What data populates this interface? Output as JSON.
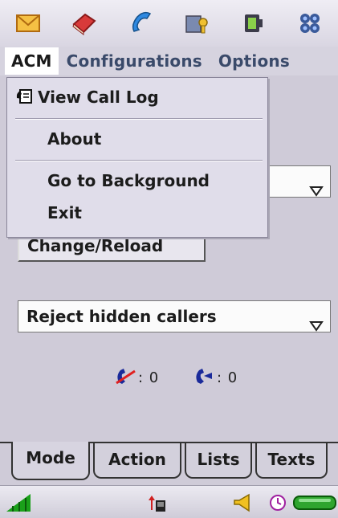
{
  "topbar": {
    "icons": [
      "mail-icon",
      "book-icon",
      "phone-icon",
      "key-icon",
      "device-icon",
      "grid-icon"
    ]
  },
  "menubar": {
    "items": [
      "ACM",
      "Configurations",
      "Options"
    ]
  },
  "dropdown": {
    "items": [
      "View Call Log",
      "About",
      "Go to Background",
      "Exit"
    ]
  },
  "content": {
    "mode_select_value": "",
    "reload_button": "Change/Reload",
    "action_select_value": "Reject hidden callers",
    "rejected_count": "0",
    "accepted_count": "0"
  },
  "tabs": [
    "Mode",
    "Action",
    "Lists",
    "Texts"
  ],
  "colors": {
    "accent_green": "#2fa52f",
    "signal_green": "#1aa01a"
  }
}
